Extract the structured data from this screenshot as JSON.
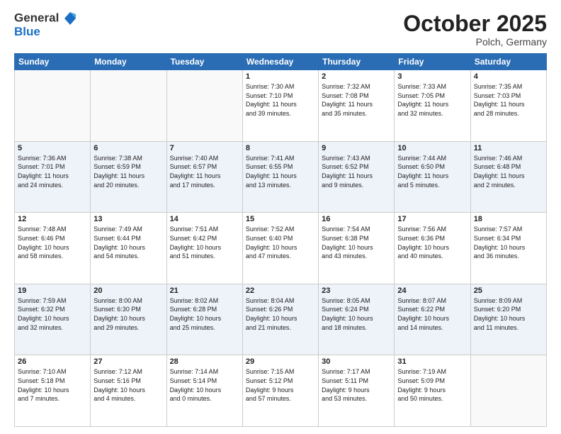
{
  "logo": {
    "general": "General",
    "blue": "Blue"
  },
  "title": "October 2025",
  "location": "Polch, Germany",
  "days_of_week": [
    "Sunday",
    "Monday",
    "Tuesday",
    "Wednesday",
    "Thursday",
    "Friday",
    "Saturday"
  ],
  "weeks": [
    [
      {
        "day": "",
        "info": ""
      },
      {
        "day": "",
        "info": ""
      },
      {
        "day": "",
        "info": ""
      },
      {
        "day": "1",
        "info": "Sunrise: 7:30 AM\nSunset: 7:10 PM\nDaylight: 11 hours\nand 39 minutes."
      },
      {
        "day": "2",
        "info": "Sunrise: 7:32 AM\nSunset: 7:08 PM\nDaylight: 11 hours\nand 35 minutes."
      },
      {
        "day": "3",
        "info": "Sunrise: 7:33 AM\nSunset: 7:05 PM\nDaylight: 11 hours\nand 32 minutes."
      },
      {
        "day": "4",
        "info": "Sunrise: 7:35 AM\nSunset: 7:03 PM\nDaylight: 11 hours\nand 28 minutes."
      }
    ],
    [
      {
        "day": "5",
        "info": "Sunrise: 7:36 AM\nSunset: 7:01 PM\nDaylight: 11 hours\nand 24 minutes."
      },
      {
        "day": "6",
        "info": "Sunrise: 7:38 AM\nSunset: 6:59 PM\nDaylight: 11 hours\nand 20 minutes."
      },
      {
        "day": "7",
        "info": "Sunrise: 7:40 AM\nSunset: 6:57 PM\nDaylight: 11 hours\nand 17 minutes."
      },
      {
        "day": "8",
        "info": "Sunrise: 7:41 AM\nSunset: 6:55 PM\nDaylight: 11 hours\nand 13 minutes."
      },
      {
        "day": "9",
        "info": "Sunrise: 7:43 AM\nSunset: 6:52 PM\nDaylight: 11 hours\nand 9 minutes."
      },
      {
        "day": "10",
        "info": "Sunrise: 7:44 AM\nSunset: 6:50 PM\nDaylight: 11 hours\nand 5 minutes."
      },
      {
        "day": "11",
        "info": "Sunrise: 7:46 AM\nSunset: 6:48 PM\nDaylight: 11 hours\nand 2 minutes."
      }
    ],
    [
      {
        "day": "12",
        "info": "Sunrise: 7:48 AM\nSunset: 6:46 PM\nDaylight: 10 hours\nand 58 minutes."
      },
      {
        "day": "13",
        "info": "Sunrise: 7:49 AM\nSunset: 6:44 PM\nDaylight: 10 hours\nand 54 minutes."
      },
      {
        "day": "14",
        "info": "Sunrise: 7:51 AM\nSunset: 6:42 PM\nDaylight: 10 hours\nand 51 minutes."
      },
      {
        "day": "15",
        "info": "Sunrise: 7:52 AM\nSunset: 6:40 PM\nDaylight: 10 hours\nand 47 minutes."
      },
      {
        "day": "16",
        "info": "Sunrise: 7:54 AM\nSunset: 6:38 PM\nDaylight: 10 hours\nand 43 minutes."
      },
      {
        "day": "17",
        "info": "Sunrise: 7:56 AM\nSunset: 6:36 PM\nDaylight: 10 hours\nand 40 minutes."
      },
      {
        "day": "18",
        "info": "Sunrise: 7:57 AM\nSunset: 6:34 PM\nDaylight: 10 hours\nand 36 minutes."
      }
    ],
    [
      {
        "day": "19",
        "info": "Sunrise: 7:59 AM\nSunset: 6:32 PM\nDaylight: 10 hours\nand 32 minutes."
      },
      {
        "day": "20",
        "info": "Sunrise: 8:00 AM\nSunset: 6:30 PM\nDaylight: 10 hours\nand 29 minutes."
      },
      {
        "day": "21",
        "info": "Sunrise: 8:02 AM\nSunset: 6:28 PM\nDaylight: 10 hours\nand 25 minutes."
      },
      {
        "day": "22",
        "info": "Sunrise: 8:04 AM\nSunset: 6:26 PM\nDaylight: 10 hours\nand 21 minutes."
      },
      {
        "day": "23",
        "info": "Sunrise: 8:05 AM\nSunset: 6:24 PM\nDaylight: 10 hours\nand 18 minutes."
      },
      {
        "day": "24",
        "info": "Sunrise: 8:07 AM\nSunset: 6:22 PM\nDaylight: 10 hours\nand 14 minutes."
      },
      {
        "day": "25",
        "info": "Sunrise: 8:09 AM\nSunset: 6:20 PM\nDaylight: 10 hours\nand 11 minutes."
      }
    ],
    [
      {
        "day": "26",
        "info": "Sunrise: 7:10 AM\nSunset: 5:18 PM\nDaylight: 10 hours\nand 7 minutes."
      },
      {
        "day": "27",
        "info": "Sunrise: 7:12 AM\nSunset: 5:16 PM\nDaylight: 10 hours\nand 4 minutes."
      },
      {
        "day": "28",
        "info": "Sunrise: 7:14 AM\nSunset: 5:14 PM\nDaylight: 10 hours\nand 0 minutes."
      },
      {
        "day": "29",
        "info": "Sunrise: 7:15 AM\nSunset: 5:12 PM\nDaylight: 9 hours\nand 57 minutes."
      },
      {
        "day": "30",
        "info": "Sunrise: 7:17 AM\nSunset: 5:11 PM\nDaylight: 9 hours\nand 53 minutes."
      },
      {
        "day": "31",
        "info": "Sunrise: 7:19 AM\nSunset: 5:09 PM\nDaylight: 9 hours\nand 50 minutes."
      },
      {
        "day": "",
        "info": ""
      }
    ]
  ]
}
